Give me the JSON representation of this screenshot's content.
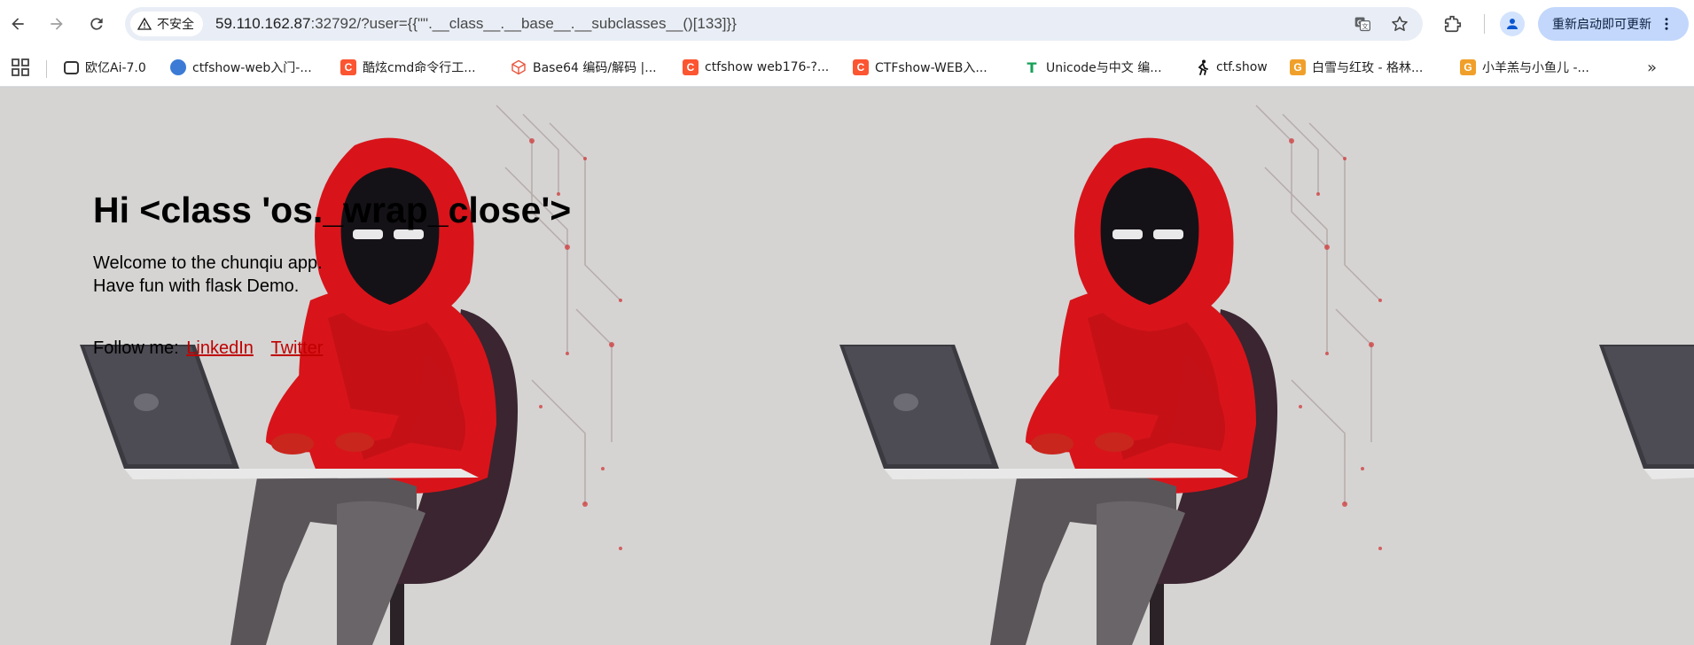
{
  "browser": {
    "security_label": "不安全",
    "url_host": "59.110.162.87",
    "url_rest": ":32792/?user={{\"\".__class__.__base__.__subclasses__()[133]}}",
    "update_button": "重新启动即可更新",
    "icons": [
      "back-icon",
      "forward-icon",
      "reload-icon",
      "warning-icon",
      "translate-icon",
      "star-icon",
      "extensions-icon",
      "profile-icon",
      "more-vert-icon"
    ]
  },
  "bookmarks": {
    "items": [
      {
        "label": "欧亿Ai-7.0",
        "icon": "ai-chat-icon"
      },
      {
        "label": "ctfshow-web入门-...",
        "icon": "globe-icon"
      },
      {
        "label": "酷炫cmd命令行工...",
        "icon": "csdn-icon"
      },
      {
        "label": "Base64 编码/解码 |...",
        "icon": "cube-icon"
      },
      {
        "label": "ctfshow web176-?...",
        "icon": "csdn-icon"
      },
      {
        "label": "CTFshow-WEB入...",
        "icon": "csdn-icon"
      },
      {
        "label": "Unicode与中文 编...",
        "icon": "tee-icon"
      },
      {
        "label": "ctf.show",
        "icon": "runner-icon"
      },
      {
        "label": "白雪与红玫 - 格林...",
        "icon": "g-icon"
      },
      {
        "label": "小羊羔与小鱼儿 -...",
        "icon": "g-icon"
      }
    ],
    "csdn_letter": "C",
    "tee_letter": "T",
    "g_letter": "G",
    "more_glyph": "»"
  },
  "page": {
    "greeting": "Hi <class 'os._wrap_close'>",
    "welcome_line1": "Welcome to the chunqiu app.",
    "welcome_line2": "Have fun with flask Demo.",
    "follow_label": "Follow me:",
    "links": [
      "LinkedIn",
      "Twitter"
    ]
  },
  "colors": {
    "accent_link": "#c00000",
    "hoodie_red": "#d8141a",
    "background_gray": "#d5d4d3"
  }
}
